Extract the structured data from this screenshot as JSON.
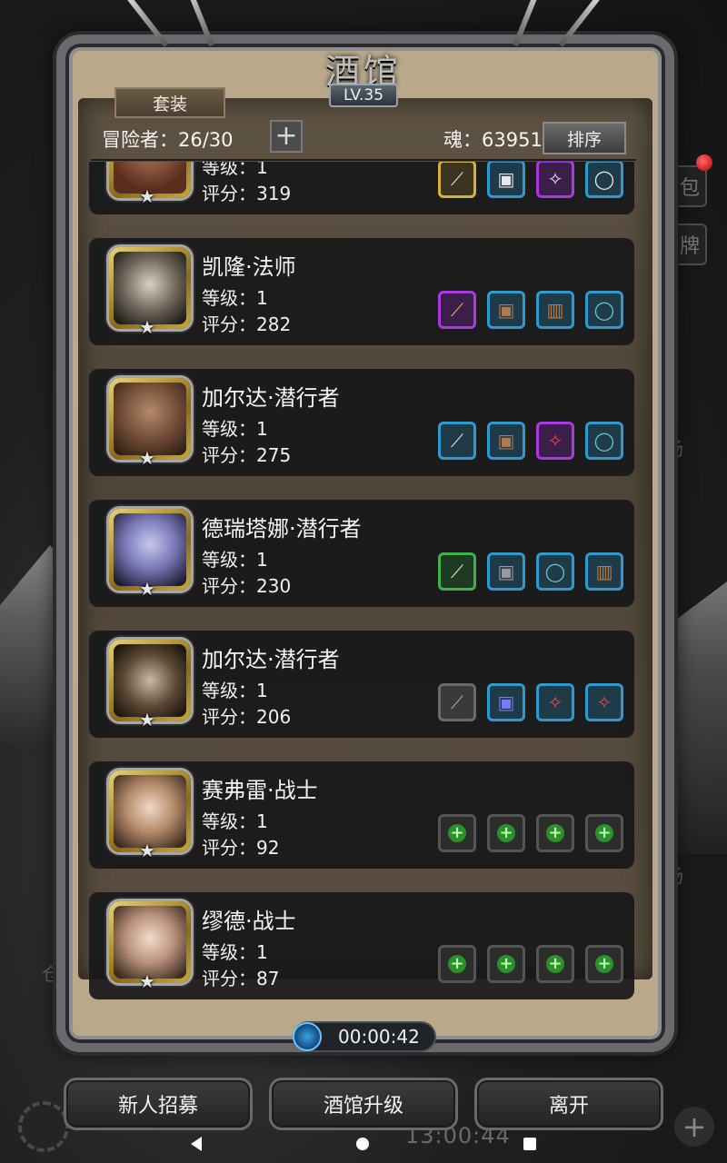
{
  "window": {
    "title": "酒馆",
    "level": "LV.35"
  },
  "header": {
    "tab_suit": "套装",
    "adventurers_label": "冒险者：26/30",
    "add_label": "+",
    "soul_label": "魂：63951",
    "sort_label": "排序"
  },
  "heroes": [
    {
      "name": "",
      "level": "等级：1",
      "score": "评分：319",
      "slots": [
        "gold",
        "blue",
        "purple",
        "blue"
      ],
      "icons": [
        "weapon-icon",
        "armor-icon",
        "amulet-icon",
        "ring-icon"
      ]
    },
    {
      "name": "凯隆·法师",
      "level": "等级：1",
      "score": "评分：282",
      "slots": [
        "purple",
        "blue",
        "blue",
        "blue"
      ],
      "icons": [
        "staff-icon",
        "armor-icon",
        "bracer-icon",
        "ring-icon"
      ]
    },
    {
      "name": "加尔达·潜行者",
      "level": "等级：1",
      "score": "评分：275",
      "slots": [
        "blue",
        "blue",
        "purple",
        "blue"
      ],
      "icons": [
        "dagger-icon",
        "armor-icon",
        "amulet-icon",
        "ring-icon"
      ]
    },
    {
      "name": "德瑞塔娜·潜行者",
      "level": "等级：1",
      "score": "评分：230",
      "slots": [
        "green",
        "blue",
        "blue",
        "blue"
      ],
      "icons": [
        "dagger-icon",
        "armor-icon",
        "ring-icon",
        "bracer-icon"
      ]
    },
    {
      "name": "加尔达·潜行者",
      "level": "等级：1",
      "score": "评分：206",
      "slots": [
        "gray",
        "blue",
        "blue",
        "blue"
      ],
      "icons": [
        "dagger-icon",
        "armor-icon",
        "amulet-icon",
        "amulet-icon"
      ]
    },
    {
      "name": "赛弗雷·战士",
      "level": "等级：1",
      "score": "评分：92",
      "slots": [
        "empty",
        "empty",
        "empty",
        "empty"
      ],
      "icons": [
        "empty-weapon-slot-icon",
        "empty-armor-slot-icon",
        "empty-accessory-slot-icon",
        "empty-accessory-slot-icon"
      ]
    },
    {
      "name": "缪德·战士",
      "level": "等级：1",
      "score": "评分：87",
      "slots": [
        "empty",
        "empty",
        "empty",
        "empty"
      ],
      "icons": [
        "empty-weapon-slot-icon",
        "empty-armor-slot-icon",
        "empty-accessory-slot-icon",
        "empty-accessory-slot-icon"
      ]
    }
  ],
  "timer": {
    "text": "00:00:42"
  },
  "buttons": {
    "recruit": "新人招募",
    "upgrade": "酒馆升级",
    "leave": "离开"
  },
  "background": {
    "clock": "13:00:44",
    "side_labels": [
      "包",
      "牌",
      "场",
      "场",
      "仓"
    ]
  },
  "colors": {
    "slot_blue": "#2f9ad0",
    "slot_purple": "#a83adf",
    "slot_gold": "#d6b23a",
    "slot_green": "#3fb34a",
    "panel_frame": "#6a6a6e"
  }
}
